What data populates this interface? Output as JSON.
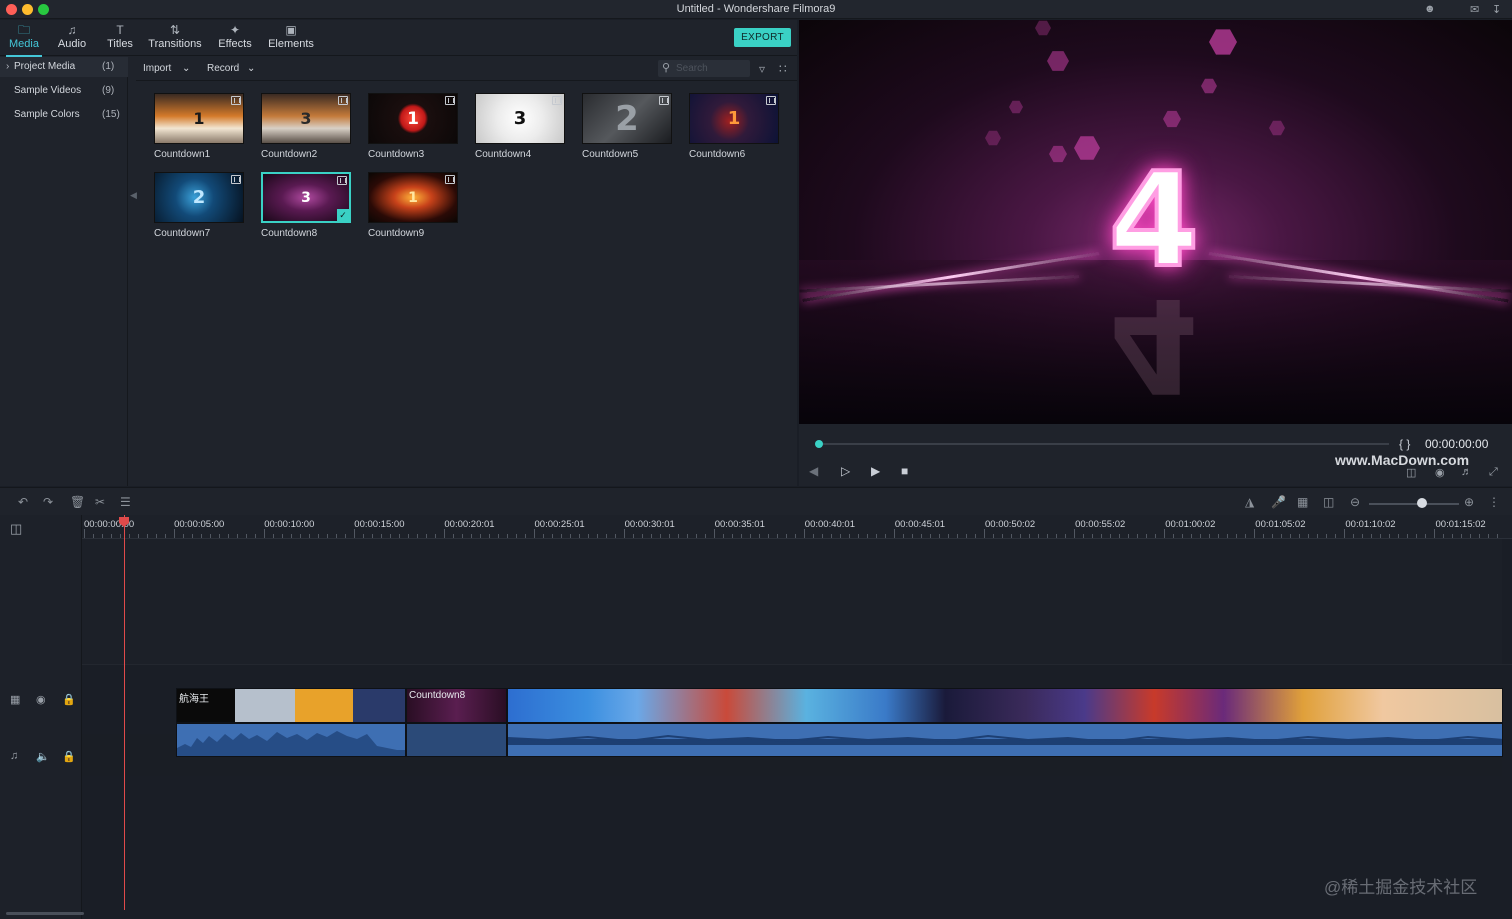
{
  "window": {
    "title": "Untitled - Wondershare Filmora9"
  },
  "tabs": [
    {
      "label": "Media",
      "icon": "folder-icon",
      "active": true
    },
    {
      "label": "Audio",
      "icon": "music-note-icon"
    },
    {
      "label": "Titles",
      "icon": "text-icon"
    },
    {
      "label": "Transitions",
      "icon": "transition-icon"
    },
    {
      "label": "Effects",
      "icon": "effects-icon"
    },
    {
      "label": "Elements",
      "icon": "image-icon"
    }
  ],
  "export_label": "EXPORT",
  "sidebar": [
    {
      "label": "Project Media",
      "count": "(1)"
    },
    {
      "label": "Sample Videos",
      "count": "(9)"
    },
    {
      "label": "Sample Colors",
      "count": "(15)"
    }
  ],
  "toolbar": {
    "import_label": "Import",
    "record_label": "Record",
    "search_placeholder": "Search"
  },
  "media": [
    {
      "name": "Countdown1",
      "glyph": "1"
    },
    {
      "name": "Countdown2",
      "glyph": "3"
    },
    {
      "name": "Countdown3",
      "glyph": "1"
    },
    {
      "name": "Countdown4",
      "glyph": "3"
    },
    {
      "name": "Countdown5",
      "glyph": "2"
    },
    {
      "name": "Countdown6",
      "glyph": "1"
    },
    {
      "name": "Countdown7",
      "glyph": "2"
    },
    {
      "name": "Countdown8",
      "glyph": "3",
      "selected": true
    },
    {
      "name": "Countdown9",
      "glyph": "1"
    }
  ],
  "preview": {
    "frame_number": "4",
    "timecode": "00:00:00:00",
    "braces": "{ }",
    "watermark": "www.MacDown.com"
  },
  "ruler": [
    "00:00:00:00",
    "00:00:05:00",
    "00:00:10:00",
    "00:00:15:00",
    "00:00:20:01",
    "00:00:25:01",
    "00:00:30:01",
    "00:00:35:01",
    "00:00:40:01",
    "00:00:45:01",
    "00:00:50:02",
    "00:00:55:02",
    "00:01:00:02",
    "00:01:05:02",
    "00:01:10:02",
    "00:01:15:02"
  ],
  "clips": [
    {
      "title": "航海王"
    },
    {
      "title": "Countdown8"
    },
    {
      "title": ""
    }
  ],
  "corner_watermark": "@稀土掘金技术社区",
  "colors": {
    "accent": "#3ad1c5",
    "playhead": "#e04a4a",
    "audio": "#3e6fb3"
  }
}
